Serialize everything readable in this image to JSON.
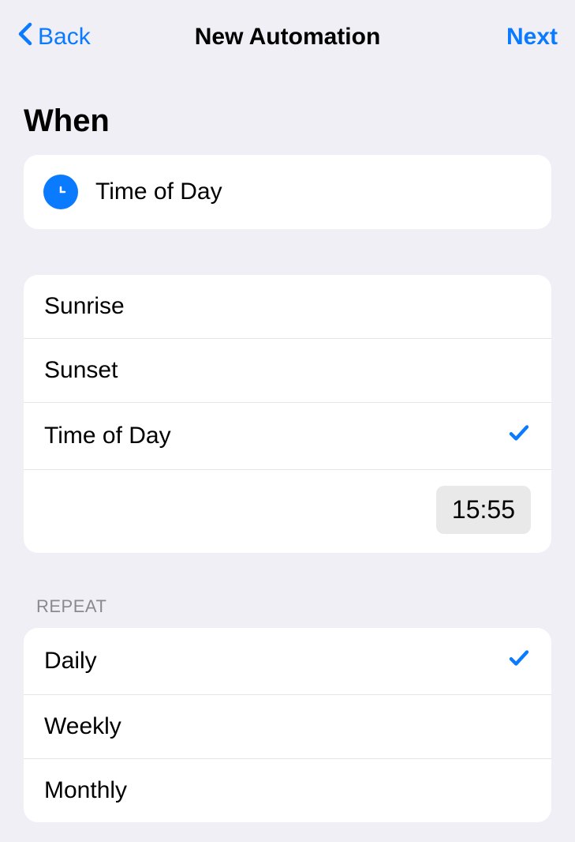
{
  "nav": {
    "back_label": "Back",
    "title": "New Automation",
    "next_label": "Next"
  },
  "when": {
    "title": "When",
    "trigger_label": "Time of Day"
  },
  "time_options": {
    "items": [
      {
        "label": "Sunrise",
        "selected": false
      },
      {
        "label": "Sunset",
        "selected": false
      },
      {
        "label": "Time of Day",
        "selected": true
      }
    ],
    "time_value": "15:55"
  },
  "repeat": {
    "header": "REPEAT",
    "items": [
      {
        "label": "Daily",
        "selected": true
      },
      {
        "label": "Weekly",
        "selected": false
      },
      {
        "label": "Monthly",
        "selected": false
      }
    ]
  }
}
